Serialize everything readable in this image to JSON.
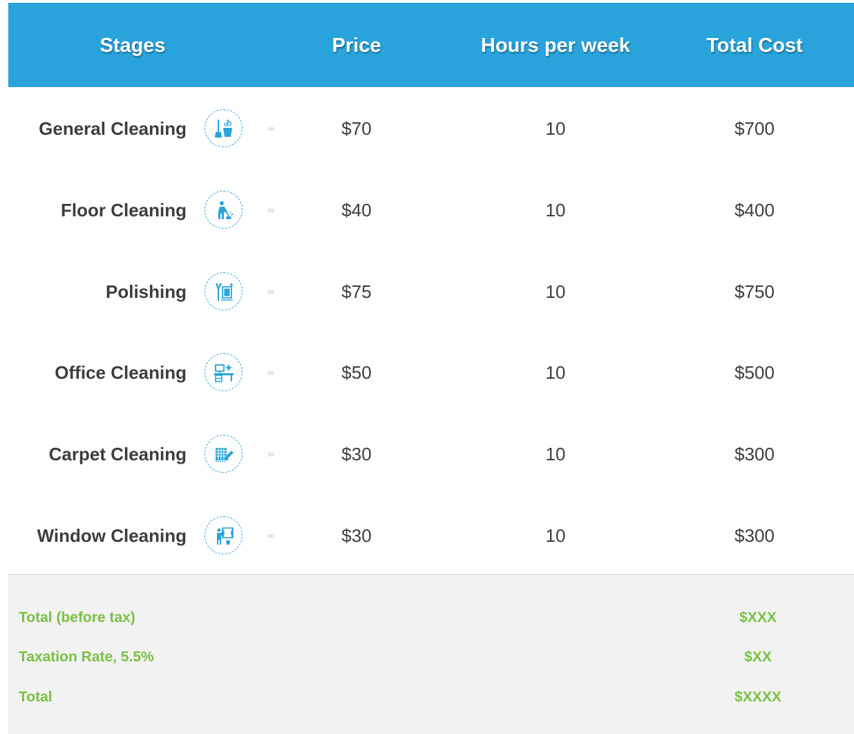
{
  "header": {
    "stages": "Stages",
    "price": "Price",
    "hours": "Hours per week",
    "total": "Total Cost"
  },
  "rows": [
    {
      "name": "General Cleaning",
      "icon": "broom-bucket-icon",
      "price": "$70",
      "hours": "10",
      "total": "$700"
    },
    {
      "name": "Floor Cleaning",
      "icon": "person-sweeping-icon",
      "price": "$40",
      "hours": "10",
      "total": "$400"
    },
    {
      "name": "Polishing",
      "icon": "window-squeegee-icon",
      "price": "$75",
      "hours": "10",
      "total": "$750"
    },
    {
      "name": "Office Cleaning",
      "icon": "office-desk-icon",
      "price": "$50",
      "hours": "10",
      "total": "$500"
    },
    {
      "name": "Carpet Cleaning",
      "icon": "carpet-brush-icon",
      "price": "$30",
      "hours": "10",
      "total": "$300"
    },
    {
      "name": "Window Cleaning",
      "icon": "person-window-icon",
      "price": "$30",
      "hours": "10",
      "total": "$300"
    }
  ],
  "arrows": "›››",
  "summary": {
    "before_tax_label": "Total (before tax)",
    "before_tax_value": "$XXX",
    "tax_label": "Taxation Rate, 5.5%",
    "tax_value": "$XX",
    "total_label": "Total",
    "total_value": "$XXXX"
  },
  "colors": {
    "header_bg": "#29a3dc",
    "icon_blue": "#29a3dc",
    "summary_green": "#7ac143",
    "summary_bg": "#f2f2f2",
    "text_dark": "#3d3d3d"
  }
}
